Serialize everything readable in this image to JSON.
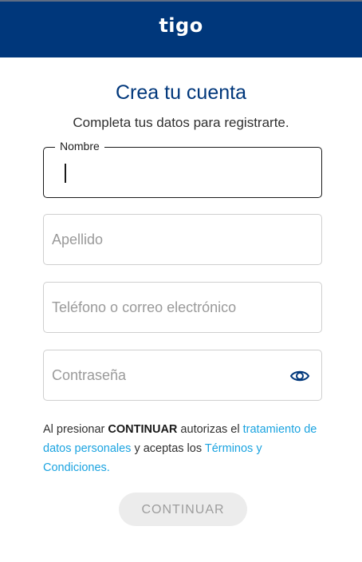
{
  "header": {
    "logo_text": "tigo",
    "background": "#00377b"
  },
  "page": {
    "title": "Crea tu cuenta",
    "subtitle": "Completa tus datos para registrarte."
  },
  "form": {
    "nombre": {
      "label": "Nombre",
      "value": ""
    },
    "apellido": {
      "placeholder": "Apellido",
      "value": ""
    },
    "contacto": {
      "placeholder": "Teléfono o correo electrónico",
      "value": ""
    },
    "password": {
      "placeholder": "Contraseña",
      "value": "",
      "toggle_icon": "eye-icon"
    }
  },
  "legal": {
    "prefix": "Al presionar ",
    "bold": "CONTINUAR",
    "middle": " autorizas el ",
    "link1": "tratamiento de datos personales",
    "middle2": " y aceptas los ",
    "link2": "Términos y Condiciones.",
    "link_color": "#1aa3e0"
  },
  "continue_button": {
    "label": "CONTINUAR",
    "state": "disabled"
  }
}
